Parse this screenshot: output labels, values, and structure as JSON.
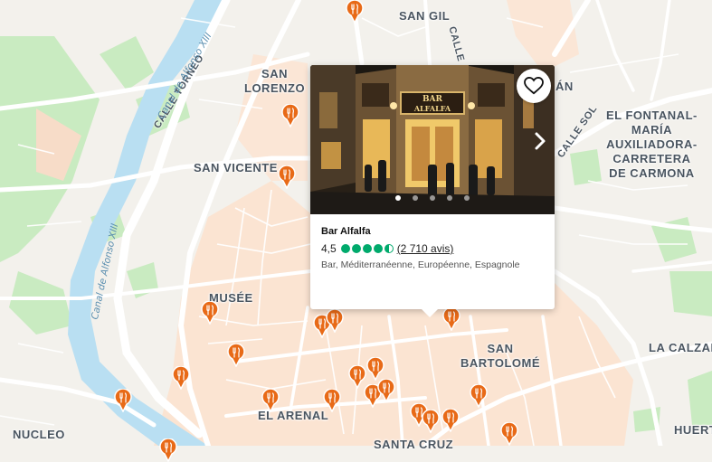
{
  "colors": {
    "land": "#f3f1ec",
    "urban": "#fbe4d2",
    "water": "#b9dff2",
    "park": "#c9ebc1",
    "road": "#ffffff",
    "pin": "#e86a17",
    "rating": "#00aa6c"
  },
  "places": {
    "san_gil": "SAN GIL",
    "san_lorenzo": "SAN\nLORENZO",
    "san_vicente": "SAN VICENTE",
    "musee": "MUSÉE",
    "el_arenal": "EL ARENAL",
    "san_bartolome": "SAN\nBARTOLOMÉ",
    "el_fontanal": "EL FONTANAL-\nMARÍA\nAUXILIADORA-\nCARRETERA\nDE CARMONA",
    "la_calzada": "LA CALZAD",
    "nucleo": "NUCLEO",
    "huerta": "HUERT",
    "santa_cruz": "SANTA CRUZ",
    "an_fragment": "ÁN"
  },
  "streets": {
    "calle_torneo": "CALLE TORNEO",
    "calle_sol": "CALLE SOL",
    "calle_top": "CALLE",
    "canal_1": "Canal de Alfonso XIII",
    "canal_2": "Canal de Alfonso XIII"
  },
  "popup": {
    "name": "Bar Alfalfa",
    "score": "4,5",
    "rating": 4.5,
    "reviews": "(2 710 avis)",
    "cuisine": "Bar, Méditerranéenne, Européenne, Espagnole",
    "photo_count": 5,
    "active_photo": 1,
    "sign_text": "BAR\nALFALFA",
    "favorite_icon": "heart-outline-icon",
    "next_icon": "chevron-right-icon"
  },
  "pins": {
    "icon": "fork-knife-icon",
    "count": 22
  }
}
